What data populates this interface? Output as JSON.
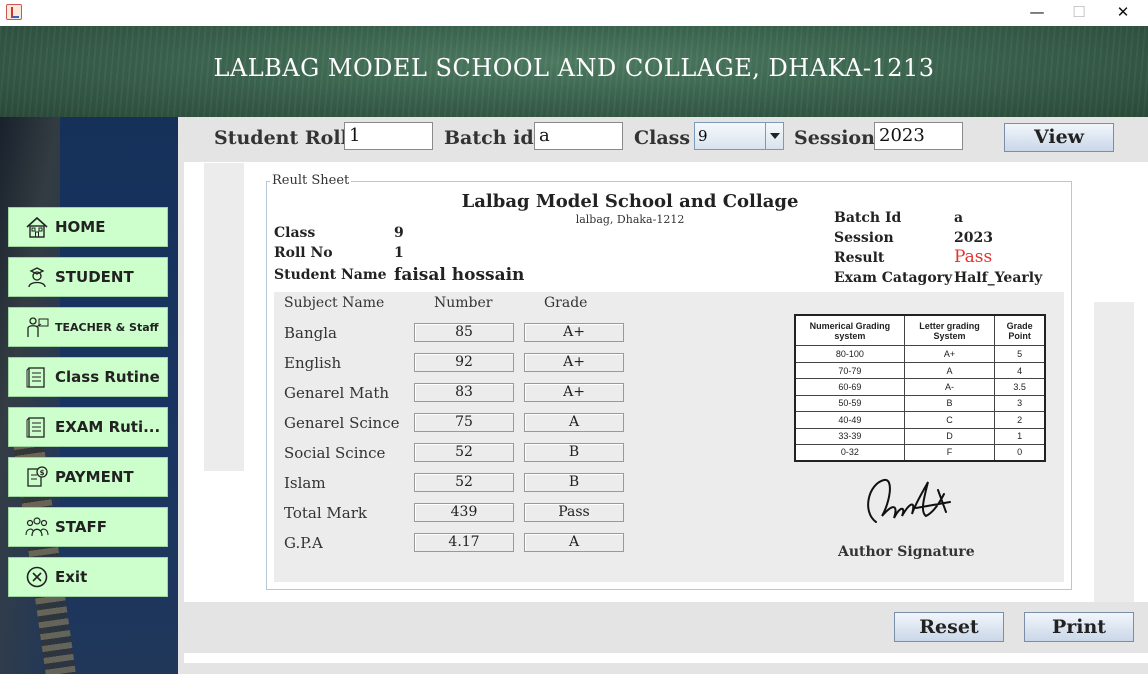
{
  "window": {
    "minimize_glyph": "—",
    "maximize_glyph": "☐",
    "close_glyph": "✕"
  },
  "banner": {
    "title": "LALBAG MODEL SCHOOL AND COLLAGE, DHAKA-1213"
  },
  "sidebar": {
    "items": [
      {
        "label": "HOME",
        "icon": "home-icon"
      },
      {
        "label": "STUDENT",
        "icon": "student-icon"
      },
      {
        "label": "TEACHER & Staff",
        "icon": "teacher-icon"
      },
      {
        "label": "Class Rutine",
        "icon": "routine-icon"
      },
      {
        "label": "EXAM Ruti...",
        "icon": "exam-routine-icon"
      },
      {
        "label": "PAYMENT",
        "icon": "payment-icon"
      },
      {
        "label": "STAFF",
        "icon": "staff-icon"
      },
      {
        "label": "Exit",
        "icon": "close-circle-icon"
      }
    ]
  },
  "search": {
    "roll_label": "Student Roll",
    "roll_value": "1",
    "batch_label": "Batch id",
    "batch_value": "a",
    "class_label": "Class",
    "class_value": "9",
    "session_label": "Session",
    "session_value": "2023",
    "view_label": "View"
  },
  "sheet": {
    "legend": "Reult Sheet",
    "school_name": "Lalbag Model School and Collage",
    "school_address": "lalbag, Dhaka-1212",
    "left_info": {
      "class_label": "Class",
      "class_value": "9",
      "roll_label": "Roll No",
      "roll_value": "1",
      "name_label": "Student Name",
      "name_value": "faisal hossain"
    },
    "right_info": {
      "batch_label": "Batch Id",
      "batch_value": "a",
      "session_label": "Session",
      "session_value": "2023",
      "result_label": "Result",
      "result_value": "Pass",
      "exam_label": "Exam Catagory",
      "exam_value": "Half_Yearly"
    },
    "grade_headers": {
      "subject": "Subject Name",
      "number": "Number",
      "grade": "Grade"
    },
    "subjects": [
      {
        "name": "Bangla",
        "number": "85",
        "grade": "A+"
      },
      {
        "name": "English",
        "number": "92",
        "grade": "A+"
      },
      {
        "name": "Genarel Math",
        "number": "83",
        "grade": "A+"
      },
      {
        "name": "Genarel Scince",
        "number": "75",
        "grade": "A"
      },
      {
        "name": "Social Scince",
        "number": "52",
        "grade": "B"
      },
      {
        "name": "Islam",
        "number": "52",
        "grade": "B"
      },
      {
        "name": "Total Mark",
        "number": "439",
        "grade": "Pass"
      },
      {
        "name": "G.P.A",
        "number": "4.17",
        "grade": "A"
      }
    ],
    "grading_table": {
      "headers": [
        "Numerical Grading system",
        "Letter grading System",
        "Grade Point"
      ],
      "rows": [
        [
          "80-100",
          "A+",
          "5"
        ],
        [
          "70-79",
          "A",
          "4"
        ],
        [
          "60-69",
          "A-",
          "3.5"
        ],
        [
          "50-59",
          "B",
          "3"
        ],
        [
          "40-49",
          "C",
          "2"
        ],
        [
          "33-39",
          "D",
          "1"
        ],
        [
          "0-32",
          "F",
          "0"
        ]
      ]
    },
    "signature_label": "Author Signature"
  },
  "actions": {
    "reset_label": "Reset",
    "print_label": "Print"
  },
  "colors": {
    "pass": "#e0342f",
    "nav_button": "#ccffcc",
    "banner": "#3c6550"
  }
}
